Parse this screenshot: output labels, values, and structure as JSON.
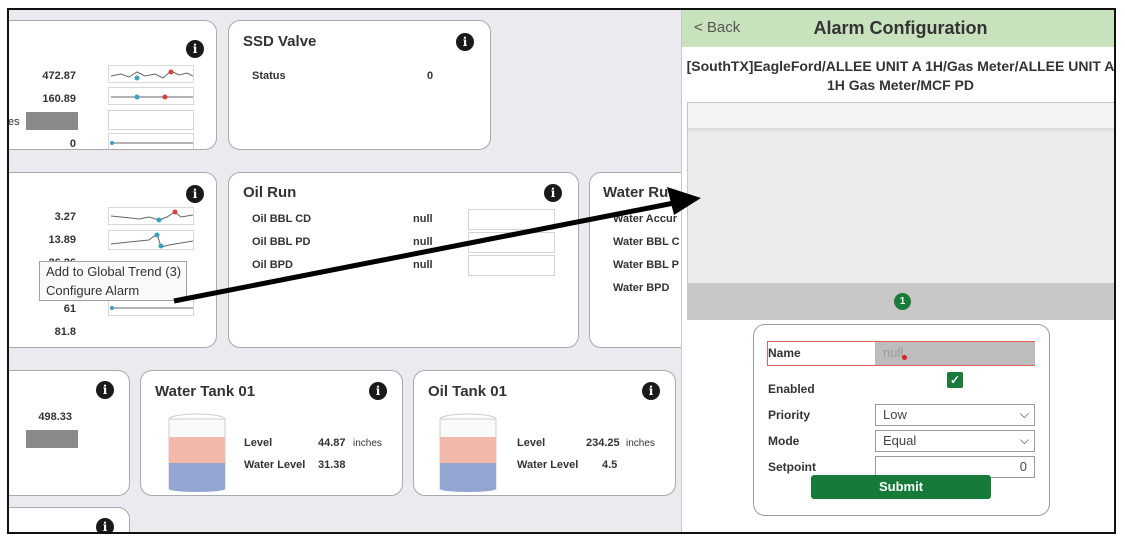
{
  "cards": {
    "card1": {
      "values": [
        "472.87",
        "160.89",
        "",
        "0"
      ],
      "partial_label": "es"
    },
    "ssd": {
      "title": "SSD Valve",
      "status_label": "Status",
      "status_value": "0"
    },
    "card3": {
      "values": [
        "3.27",
        "13.89",
        "26.26",
        "61",
        "81.8"
      ]
    },
    "oil_run": {
      "title": "Oil Run",
      "rows": [
        {
          "label": "Oil BBL CD",
          "value": "null"
        },
        {
          "label": "Oil BBL PD",
          "value": "null"
        },
        {
          "label": "Oil BPD",
          "value": "null"
        }
      ]
    },
    "water_run": {
      "title": "Water Ru",
      "rows": [
        "Water Accur",
        "Water BBL C",
        "Water BBL P",
        "Water BPD"
      ]
    },
    "card6": {
      "value": "498.33"
    },
    "water_tank": {
      "title": "Water Tank 01",
      "level_label": "Level",
      "level_value": "44.87",
      "level_unit": "inches",
      "water_label": "Water Level",
      "water_value": "31.38"
    },
    "oil_tank": {
      "title": "Oil Tank 01",
      "level_label": "Level",
      "level_value": "234.25",
      "level_unit": "inches",
      "water_label": "Water Level",
      "water_value": "4.5"
    }
  },
  "context_menu": {
    "items": [
      "Add to Global Trend (3)",
      "Configure Alarm"
    ]
  },
  "panel": {
    "back_label": "< Back",
    "title": "Alarm Configuration",
    "path": "[SouthTX]EagleFord/ALLEE UNIT A 1H/Gas Meter/ALLEE UNIT A 1H Gas Meter/MCF PD",
    "page_number": "1",
    "form": {
      "name_label": "Name",
      "name_value": "null",
      "enabled_label": "Enabled",
      "enabled_checked": true,
      "priority_label": "Priority",
      "priority_value": "Low",
      "mode_label": "Mode",
      "mode_value": "Equal",
      "setpoint_label": "Setpoint",
      "setpoint_value": "0",
      "submit_label": "Submit"
    }
  },
  "icons": {
    "info": "info-icon",
    "check": "check-icon",
    "chevron": "chevron-down-icon",
    "back": "back-icon"
  },
  "colors": {
    "header_green": "#c7e2bd",
    "brand_green": "#157a3a",
    "tank_top": "#f3b9a8",
    "tank_bottom": "#93a6d2",
    "spark_red": "#d94040",
    "spark_teal": "#3aa0c0"
  }
}
